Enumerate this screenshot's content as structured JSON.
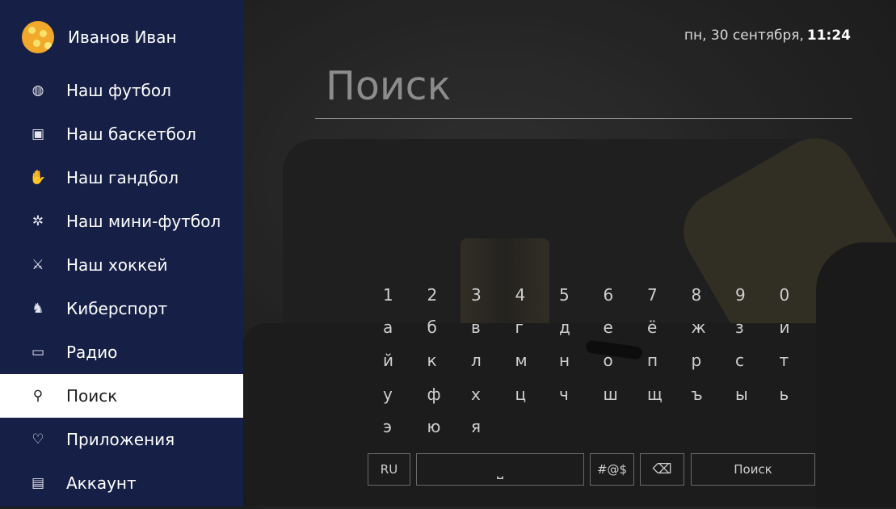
{
  "user": {
    "name": "Иванов Иван"
  },
  "menu": [
    {
      "label": "Наш футбол",
      "icon": "football-icon",
      "glyph": "◍"
    },
    {
      "label": "Наш баскетбол",
      "icon": "basketball-icon",
      "glyph": "▣"
    },
    {
      "label": "Наш гандбол",
      "icon": "handball-icon",
      "glyph": "✋"
    },
    {
      "label": "Наш мини-футбол",
      "icon": "mini-football-icon",
      "glyph": "✲"
    },
    {
      "label": "Наш хоккей",
      "icon": "hockey-icon",
      "glyph": "⚔"
    },
    {
      "label": "Киберспорт",
      "icon": "cybersport-icon",
      "glyph": "♞"
    },
    {
      "label": "Радио",
      "icon": "radio-icon",
      "glyph": "▭"
    },
    {
      "label": "Поиск",
      "icon": "search-icon",
      "glyph": "⚲",
      "active": true
    },
    {
      "label": "Приложения",
      "icon": "apps-icon",
      "glyph": "♡"
    },
    {
      "label": "Аккаунт",
      "icon": "account-icon",
      "glyph": "▤"
    }
  ],
  "header": {
    "date": "пн, 30 сентября,",
    "time": "11:24"
  },
  "search": {
    "title": "Поиск"
  },
  "keyboard": {
    "rows": [
      [
        "1",
        "2",
        "3",
        "4",
        "5",
        "6",
        "7",
        "8",
        "9",
        "0"
      ],
      [
        "а",
        "б",
        "в",
        "г",
        "д",
        "е",
        "ё",
        "ж",
        "з",
        "и"
      ],
      [
        "й",
        "к",
        "л",
        "м",
        "н",
        "о",
        "п",
        "р",
        "с",
        "т"
      ],
      [
        "у",
        "ф",
        "х",
        "ц",
        "ч",
        "ш",
        "щ",
        "ъ",
        "ы",
        "ь"
      ],
      [
        "э",
        "ю",
        "я"
      ]
    ],
    "lang": "RU",
    "space_glyph": "⎵",
    "symbols": "#@$",
    "backspace_glyph": "⌫",
    "submit": "Поиск"
  },
  "colors": {
    "sidebar": "#162046",
    "active_item": "#ffffff",
    "text": "#ffffff"
  }
}
